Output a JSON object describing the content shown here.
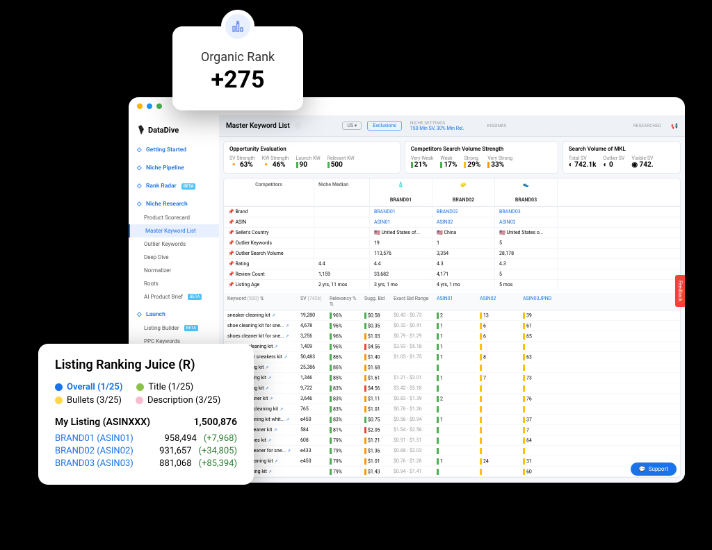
{
  "organic_rank": {
    "label": "Organic Rank",
    "value": "+275"
  },
  "brand": "DataDive",
  "nav": {
    "items": [
      {
        "label": "Getting Started",
        "type": "sect"
      },
      {
        "label": "Niche Pipeline",
        "type": "sect"
      },
      {
        "label": "Rank Radar",
        "type": "sect",
        "beta": true
      },
      {
        "label": "Niche Research",
        "type": "sect"
      },
      {
        "label": "Product Scorecard",
        "type": "sub"
      },
      {
        "label": "Master Keyword List",
        "type": "sub",
        "active": true
      },
      {
        "label": "Outlier Keywords",
        "type": "sub"
      },
      {
        "label": "Deep Dive",
        "type": "sub"
      },
      {
        "label": "Normalizer",
        "type": "sub"
      },
      {
        "label": "Roots",
        "type": "sub"
      },
      {
        "label": "AI Product Brief",
        "type": "sub",
        "beta": true
      },
      {
        "label": "Launch",
        "type": "sect"
      },
      {
        "label": "Listing Builder",
        "type": "sub",
        "beta": true
      },
      {
        "label": "PPC Keywords",
        "type": "sub"
      }
    ]
  },
  "header": {
    "title": "Master Keyword List",
    "region": "US",
    "exclusions": "Exclusions",
    "settings": "NICHE SETTINGS",
    "settings_sub": "150 Min SV, 30% Min Rel.",
    "kissinks": "KISSINKS",
    "researched": "RESEARCHED"
  },
  "opportunity": {
    "title": "Opportunity Evaluation",
    "sv_strength": {
      "l": "SV Strength",
      "v": "63%"
    },
    "kw_strength": {
      "l": "KW Strength",
      "v": "46%"
    },
    "launch_kw": {
      "l": "Launch KW",
      "v": "90"
    },
    "relevant_kw": {
      "l": "Relevant KW",
      "v": "500"
    }
  },
  "competitors": {
    "title": "Competitors Search Volume Strength",
    "very_weak": {
      "l": "Very Weak",
      "v": "21%"
    },
    "weak": {
      "l": "Weak",
      "v": "17%"
    },
    "strong": {
      "l": "Strong",
      "v": "29%"
    },
    "very_strong": {
      "l": "Very Strong",
      "v": "33%"
    }
  },
  "svmkl": {
    "title": "Search Volume of MKL",
    "total": {
      "l": "Total SV",
      "v": "742.1k"
    },
    "outlier": {
      "l": "Outlier SV",
      "v": "0"
    },
    "visible": {
      "l": "Visible SV",
      "v": "742."
    }
  },
  "comp_table": {
    "h_comp": "Competitors",
    "h_med": "Niche Median",
    "brands": [
      {
        "name": "BRAND01",
        "asin": "ASIN01",
        "country": "United States of...",
        "okw": "19",
        "osv": "113,576",
        "rating": "4.4",
        "reviews": "33,682",
        "age": "3 yrs, 1 mo"
      },
      {
        "name": "BRAND02",
        "asin": "ASIN02",
        "country": "China",
        "okw": "1",
        "osv": "3,354",
        "rating": "4.3",
        "reviews": "4,171",
        "age": "4 yrs, 1 mo"
      },
      {
        "name": "BRAND03",
        "asin": "ASIN03",
        "country": "United States o...",
        "okw": "5",
        "osv": "28,178",
        "rating": "4.3",
        "reviews": "5",
        "age": "5 mos"
      }
    ],
    "rows": [
      "Brand",
      "ASIN",
      "Seller's Country",
      "Outlier Keywords",
      "Outlier Search Volume",
      "Rating",
      "Review Count",
      "Listing Age"
    ],
    "median": {
      "rating": "4.4",
      "reviews": "1,159",
      "age": "2 yrs, 11 mos"
    }
  },
  "kw": {
    "hdr": {
      "kw": "Keyword",
      "kw_ct": "(500)",
      "sv": "SV",
      "sv_ct": "(742k)",
      "rel": "Relevancy %",
      "bid": "Sugg. Bid",
      "range": "Exact Bid Range",
      "b1": "ASIN01",
      "b2": "ASIN02",
      "b3": "ASIN03JPND"
    },
    "rows": [
      {
        "kw": "sneaker cleaning kit",
        "sv": "19,280",
        "rel": "96%",
        "bid": "$0.58",
        "rng": "$0.43 - $0.73",
        "b1": "2",
        "b2": "13",
        "b3": "39"
      },
      {
        "kw": "shoe cleaning kit for sne...",
        "sv": "4,678",
        "rel": "96%",
        "bid": "$0.35",
        "rng": "$0.32 - $0.41",
        "b1": "1",
        "b2": "6",
        "b3": "61"
      },
      {
        "kw": "shoes cleaner kit for sne...",
        "sv": "3,256",
        "rel": "96%",
        "bid": "$1.03",
        "rng": "$0.79 - $1.29",
        "b1": "1",
        "b2": "6",
        "b3": "65"
      },
      {
        "kw": "sneakers cleaning kit",
        "sv": "1,409",
        "rel": "96%",
        "bid": "$4.56",
        "rng": "$3.93 - $5.18",
        "b1": "1",
        "b2": "",
        "b3": ""
      },
      {
        "kw": "shoe cleaner sneakers kit",
        "sv": "50,483",
        "rel": "86%",
        "bid": "$1.40",
        "rng": "$1.05 - $1.75",
        "b1": "1",
        "b2": "8",
        "b3": "63"
      },
      {
        "kw": "shoe cleaning kit",
        "sv": "25,386",
        "rel": "86%",
        "bid": "$1.68",
        "rng": "",
        "b1": "",
        "b2": "",
        "b3": ""
      },
      {
        "kw": "shoes cleaning kit",
        "sv": "1,346",
        "rel": "85%",
        "bid": "$1.61",
        "rng": "$1.21 - $2.01",
        "b1": "1",
        "b2": "7",
        "b3": "73"
      },
      {
        "kw": "shoe cleaning kit",
        "sv": "9,722",
        "rel": "83%",
        "bid": "$4.56",
        "rng": "$3.42 - $5.18",
        "b1": "",
        "b2": "",
        "b3": ""
      },
      {
        "kw": "sneaker cleaner kit",
        "sv": "3,646",
        "rel": "83%",
        "bid": "$1.11",
        "rng": "$0.83 - $1.39",
        "b1": "2",
        "b2": "",
        "b3": "76"
      },
      {
        "kw": "tennis shoe cleaning kit",
        "sv": "765",
        "rel": "83%",
        "bid": "$1.01",
        "rng": "$0.76 - $1.26",
        "b1": "",
        "b2": "",
        "b3": ""
      },
      {
        "kw": "sneaker cleaning kit whit...",
        "sv": "e450",
        "rel": "83%",
        "bid": "$0.75",
        "rng": "$0.56 - $0.94",
        "b1": "1",
        "b2": "",
        "b3": "37"
      },
      {
        "kw": "crep shoe cleaner kit",
        "sv": "584",
        "rel": "81%",
        "bid": "$2.05",
        "rng": "$1.54 - $2.56",
        "b1": "",
        "b2": "",
        "b3": "7"
      },
      {
        "kw": "cleaning shoes kit",
        "sv": "608",
        "rel": "79%",
        "bid": "$1.21",
        "rng": "$0.91 - $1.51",
        "b1": "",
        "b2": "",
        "b3": "64"
      },
      {
        "kw": "best shoe cleaner for sne...",
        "sv": "e433",
        "rel": "79%",
        "bid": "$1.36",
        "rng": "$0.68 - $2.03",
        "b1": "",
        "b2": "",
        "b3": ""
      },
      {
        "kw": "converse cleaning kit",
        "sv": "e450",
        "rel": "79%",
        "bid": "$1.01",
        "rng": "$0.76 - $1.26",
        "b1": "1",
        "b2": "24",
        "b3": "31"
      },
      {
        "kw": "jordan cleaning kit",
        "sv": "",
        "rel": "79%",
        "bid": "$1.43",
        "rng": "$0.94 - $1.41",
        "b1": "",
        "b2": "",
        "b3": "60"
      }
    ]
  },
  "support": "Support",
  "feedback": "Feedback",
  "juice": {
    "title": "Listing Ranking Juice (R)",
    "legend": {
      "overall": "Overall (1/25)",
      "title": "Title (1/25)",
      "bullets": "Bullets (3/25)",
      "desc": "Description (3/25)"
    },
    "my": {
      "label": "My Listing (ASINXXX)",
      "val": "1,500,876"
    },
    "brands": [
      {
        "name": "BRAND01 (ASIN01)",
        "val": "958,494",
        "delta": "(+7,968)"
      },
      {
        "name": "BRAND02 (ASIN02)",
        "val": "931,657",
        "delta": "(+34,805)"
      },
      {
        "name": "BRAND03 (ASIN03)",
        "val": "881,068",
        "delta": "(+85,394)"
      }
    ]
  }
}
